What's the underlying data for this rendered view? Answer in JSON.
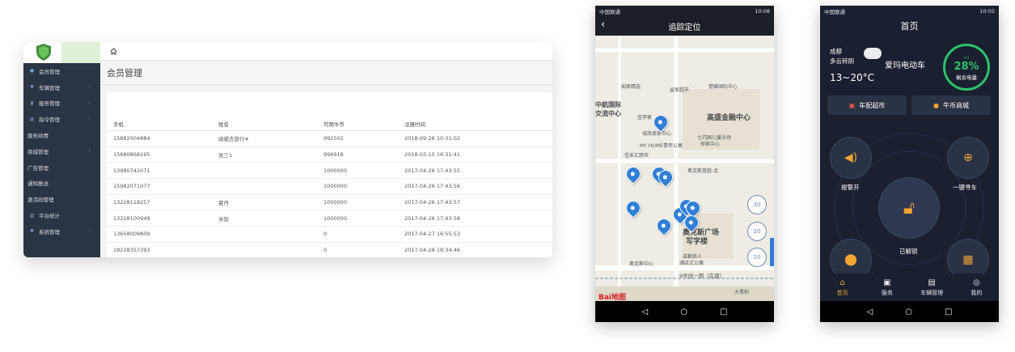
{
  "admin": {
    "menu": [
      {
        "icon": "user-icon",
        "label": "会员管理",
        "has_children": false
      },
      {
        "icon": "gear-icon",
        "label": "车辆管理",
        "has_children": true
      },
      {
        "icon": "chart-icon",
        "label": "服务管理",
        "has_children": true
      },
      {
        "icon": "command-icon",
        "label": "指令管理",
        "has_children": true
      },
      {
        "icon": "",
        "label": "服务续费",
        "has_children": false
      },
      {
        "icon": "",
        "label": "商城管理",
        "has_children": true
      },
      {
        "icon": "",
        "label": "广告管理",
        "has_children": false
      },
      {
        "icon": "",
        "label": "通知推送",
        "has_children": false
      },
      {
        "icon": "",
        "label": "激活码管理",
        "has_children": false
      },
      {
        "icon": "stats-icon",
        "label": "平台统计",
        "has_children": false
      },
      {
        "icon": "settings-icon",
        "label": "系统管理",
        "has_children": true
      }
    ],
    "page_title": "会员管理",
    "table": {
      "headers": [
        "手机",
        "姓名",
        "可用牛币",
        "注册时间"
      ],
      "rows": [
        [
          "15882004884",
          "骑猪去旅行✈",
          "992502",
          "2018-09-26 10:31:02"
        ],
        [
          "15680868195",
          "张三1",
          "996918",
          "2018-03-15 16:31:41"
        ],
        [
          "13980742071",
          "",
          "1000000",
          "2017-04-26 17:43:55"
        ],
        [
          "15982071077",
          "",
          "1000000",
          "2017-04-26 17:43:56"
        ],
        [
          "13228118257",
          "夏丹",
          "1000000",
          "2017-04-26 17:43:57"
        ],
        [
          "13228100949",
          "米饭",
          "1000000",
          "2017-04-26 17:43:58"
        ],
        [
          "13658009809",
          "",
          "0",
          "2017-04-27 16:55:53"
        ],
        [
          "18228357393",
          "",
          "0",
          "2017-04-28 18:34:46"
        ]
      ]
    }
  },
  "phone_map": {
    "status": {
      "carrier": "中国联通",
      "time": "10:08"
    },
    "title": "追踪定位",
    "labels": [
      {
        "text": "如家精选",
        "pos": "a"
      },
      {
        "text": "益家超市",
        "pos": "b"
      },
      {
        "text": "楚峰国际中心",
        "pos": "c"
      },
      {
        "text": "中航国际",
        "pos": "d"
      },
      {
        "text": "交流中心",
        "pos": "e"
      },
      {
        "text": "金李家",
        "pos": "f"
      },
      {
        "text": "高盛金融中心",
        "pos": "g"
      },
      {
        "text": "城南美家中心",
        "pos": "h"
      },
      {
        "text": "七巧国儿童乐场",
        "pos": "i"
      },
      {
        "text": "探索中心",
        "pos": "j"
      },
      {
        "text": "MY HOME青年公寓",
        "pos": "k"
      },
      {
        "text": "佳禾汇颜市",
        "pos": "l"
      },
      {
        "text": "奥克斯宽庭-北",
        "pos": "m"
      },
      {
        "text": "奥克斯广场",
        "pos": "n"
      },
      {
        "text": "写字楼",
        "pos": "o"
      },
      {
        "text": "成都依人",
        "pos": "p"
      },
      {
        "text": "酒店式公寓",
        "pos": "q"
      },
      {
        "text": "奥克斯中心",
        "pos": "r"
      },
      {
        "text": "9号线一期（在建）",
        "pos": "s"
      },
      {
        "text": "大晋和",
        "pos": "t"
      }
    ],
    "zoom_buttons": [
      "30",
      "20",
      "10"
    ],
    "map_logo": "Bai地图"
  },
  "phone_home": {
    "status": {
      "carrier": "中国联通",
      "time": "10:05"
    },
    "title": "首页",
    "weather": {
      "city": "成都",
      "desc": "多云转阴",
      "temp": "13~20°C"
    },
    "brand": "爱玛电动车",
    "battery": {
      "percent": "28%",
      "label": "剩余电量",
      "level": 0.28
    },
    "shortcuts": [
      "车配超市",
      "牛币商城"
    ],
    "controls": {
      "alarm": "报警开",
      "find": "一键寻车",
      "lock_state": "已解锁"
    },
    "tabs": [
      {
        "label": "首页",
        "icon": "home-icon",
        "active": true
      },
      {
        "label": "服务",
        "icon": "gift-icon",
        "active": false
      },
      {
        "label": "车辆管理",
        "icon": "document-icon",
        "active": false
      },
      {
        "label": "我的",
        "icon": "profile-icon",
        "active": false
      }
    ],
    "colors": {
      "accent": "#f3a531",
      "battery": "#2dc26b",
      "background": "#1a2030"
    }
  }
}
